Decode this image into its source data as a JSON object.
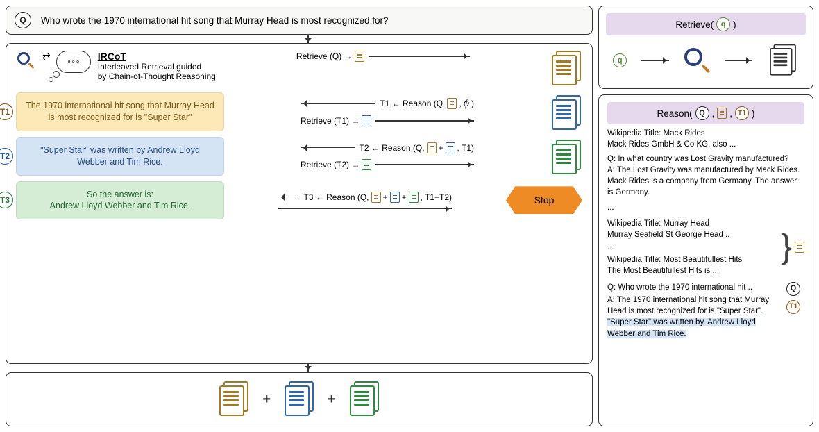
{
  "question": "Who wrote the 1970 international hit song that Murray Head is most recognized for?",
  "labels": {
    "Q": "Q",
    "q": "q",
    "T1": "T1",
    "T2": "T2",
    "T3": "T3"
  },
  "method": {
    "title": "IRCoT",
    "subtitle1": "Interleaved Retrieval guided",
    "subtitle2": "by Chain-of-Thought Reasoning"
  },
  "thoughts": {
    "t1": "The 1970 international hit song that Murray Head is most recognized for is \"Super Star\"",
    "t2": "\"Super Star\" was written by Andrew Lloyd Webber and Tim Rice.",
    "t3": "So the answer is:\nAndrew Lloyd Webber and Tim Rice."
  },
  "actions": {
    "retrieveQ": "Retrieve (Q) →",
    "reason1_pre": "T1 ← Reason (Q,",
    "reason1_post": ")",
    "retrieveT1": "Retrieve (T1) →",
    "reason2_pre": "T2 ← Reason (Q,",
    "reason2_post": ", T1)",
    "retrieveT2": "Retrieve (T2) →",
    "reason3_pre": "T3 ← Reason (Q,",
    "reason3_post": ", T1+T2)",
    "stop": "Stop",
    "phi": "ϕ",
    "plus": "+"
  },
  "retrieve_box": {
    "header": "Retrieve(",
    "header_close": ")"
  },
  "reason_box": {
    "header_pre": "Reason(",
    "header_post": ")",
    "wiki1_title": "Wikipedia Title: Mack Rides",
    "wiki1_body": "Mack Rides GmbH & Co KG, also ...",
    "exQ": "Q: In what country was Lost Gravity manufactured?",
    "exA": "A: The Lost Gravity was manufactured by Mack Rides. Mack Rides is a company from Germany. The answer is Germany.",
    "dots": "...",
    "wiki2_title": "Wikipedia Title: Murray Head",
    "wiki2_body": "Murray Seafield St George Head ..",
    "wiki3_title": "Wikipedia Title: Most Beautifullest Hits",
    "wiki3_body": "The Most Beautifullest Hits is ...",
    "promptQ": "Q: Who wrote the 1970 international hit ..",
    "promptA_pre": "A: The 1970 international hit song that Murray Head is most recognized for is \"Super Star\". ",
    "promptA_hl": "\"Super Star\" was written by. Andrew Lloyd Webber and Tim Rice."
  }
}
